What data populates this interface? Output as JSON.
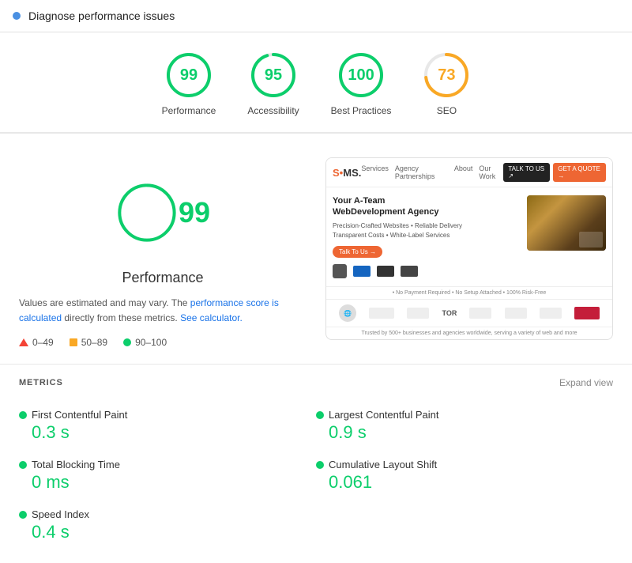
{
  "header": {
    "title": "Diagnose performance issues"
  },
  "scores": [
    {
      "id": "performance",
      "value": 99,
      "label": "Performance",
      "color": "#0cce6b",
      "strokeColor": "#0cce6b",
      "radius": 26
    },
    {
      "id": "accessibility",
      "value": 95,
      "label": "Accessibility",
      "color": "#0cce6b",
      "strokeColor": "#0cce6b",
      "radius": 26
    },
    {
      "id": "best-practices",
      "value": 100,
      "label": "Best Practices",
      "color": "#0cce6b",
      "strokeColor": "#0cce6b",
      "radius": 26
    },
    {
      "id": "seo",
      "value": 73,
      "label": "SEO",
      "color": "#f9a825",
      "strokeColor": "#f9a825",
      "radius": 26
    }
  ],
  "performance_detail": {
    "score": 99,
    "label": "Performance",
    "description_prefix": "Values are estimated and may vary. The ",
    "link1_text": "performance score is calculated",
    "description_mid": " directly from these metrics. ",
    "link2_text": "See calculator.",
    "legend": [
      {
        "type": "triangle",
        "range": "0–49"
      },
      {
        "type": "square",
        "range": "50–89"
      },
      {
        "type": "circle",
        "range": "90–100"
      }
    ]
  },
  "preview": {
    "logo": "S•MS.",
    "nav_items": [
      "Services",
      "Agency Partnerships",
      "About",
      "Our Work"
    ],
    "btn_talk": "TALK TO US",
    "btn_quote": "GET A QUOTE →",
    "hero_title": "Your A-Team\nWebDevelopment Agency",
    "hero_bullets": [
      "Precision-Crafted Websites  •  Reliable Delivery",
      "Transparent Costs  •  White-Label Services"
    ],
    "hero_cta": "Talk To Us →",
    "footer_text": "Trusted by 500+ businesses and agencies worldwide, serving a variety of web and more",
    "trust_note": "• No Payment Required  • No Setup Attached  • 100% Risk-Free"
  },
  "metrics": {
    "title": "METRICS",
    "expand_label": "Expand view",
    "items": [
      {
        "name": "First Contentful Paint",
        "value": "0.3 s",
        "color": "#0cce6b"
      },
      {
        "name": "Largest Contentful Paint",
        "value": "0.9 s",
        "color": "#0cce6b"
      },
      {
        "name": "Total Blocking Time",
        "value": "0 ms",
        "color": "#0cce6b"
      },
      {
        "name": "Cumulative Layout Shift",
        "value": "0.061",
        "color": "#0cce6b"
      },
      {
        "name": "Speed Index",
        "value": "0.4 s",
        "color": "#0cce6b"
      }
    ]
  }
}
